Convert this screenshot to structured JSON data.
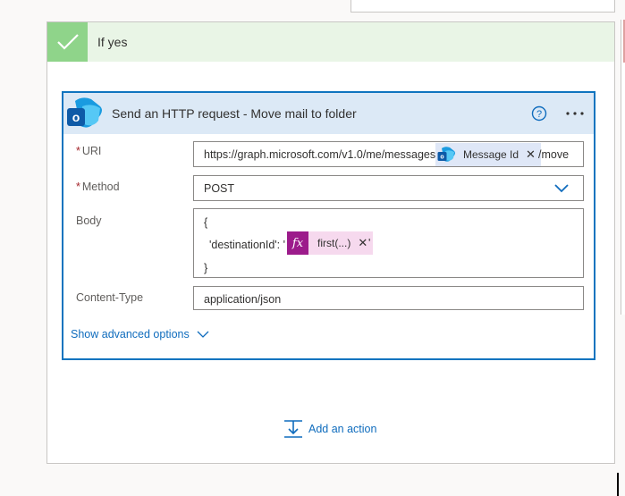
{
  "condition": {
    "title": "If yes"
  },
  "action": {
    "title": "Send an HTTP request - Move mail to folder",
    "uri": {
      "label": "URI",
      "prefix": "https://graph.microsoft.com/v1.0/me/messages/",
      "token_label": "Message Id",
      "suffix": "/move"
    },
    "method": {
      "label": "Method",
      "value": "POST"
    },
    "body": {
      "label": "Body",
      "line1": "{",
      "line2_prefix": "'destinationId': '",
      "fx_label": "first(...)",
      "line2_suffix": "'",
      "line3": "}"
    },
    "content_type": {
      "label": "Content-Type",
      "value": "application/json"
    },
    "advanced_link": "Show advanced options"
  },
  "add_action": "Add an action",
  "colors": {
    "card_border": "#0f74bf",
    "card_header": "#dce9f6",
    "condition_header": "#e9f5e6",
    "condition_check": "#8fd48a",
    "fx_badge": "#9c1b8b",
    "fx_token": "#f6d9ee",
    "link": "#0f6cbd",
    "required": "#a4262c"
  },
  "icons": [
    "checkmark-icon",
    "outlook-icon",
    "help-icon",
    "more-options-icon",
    "close-icon",
    "chevron-down-icon",
    "fx-icon",
    "add-action-icon"
  ]
}
